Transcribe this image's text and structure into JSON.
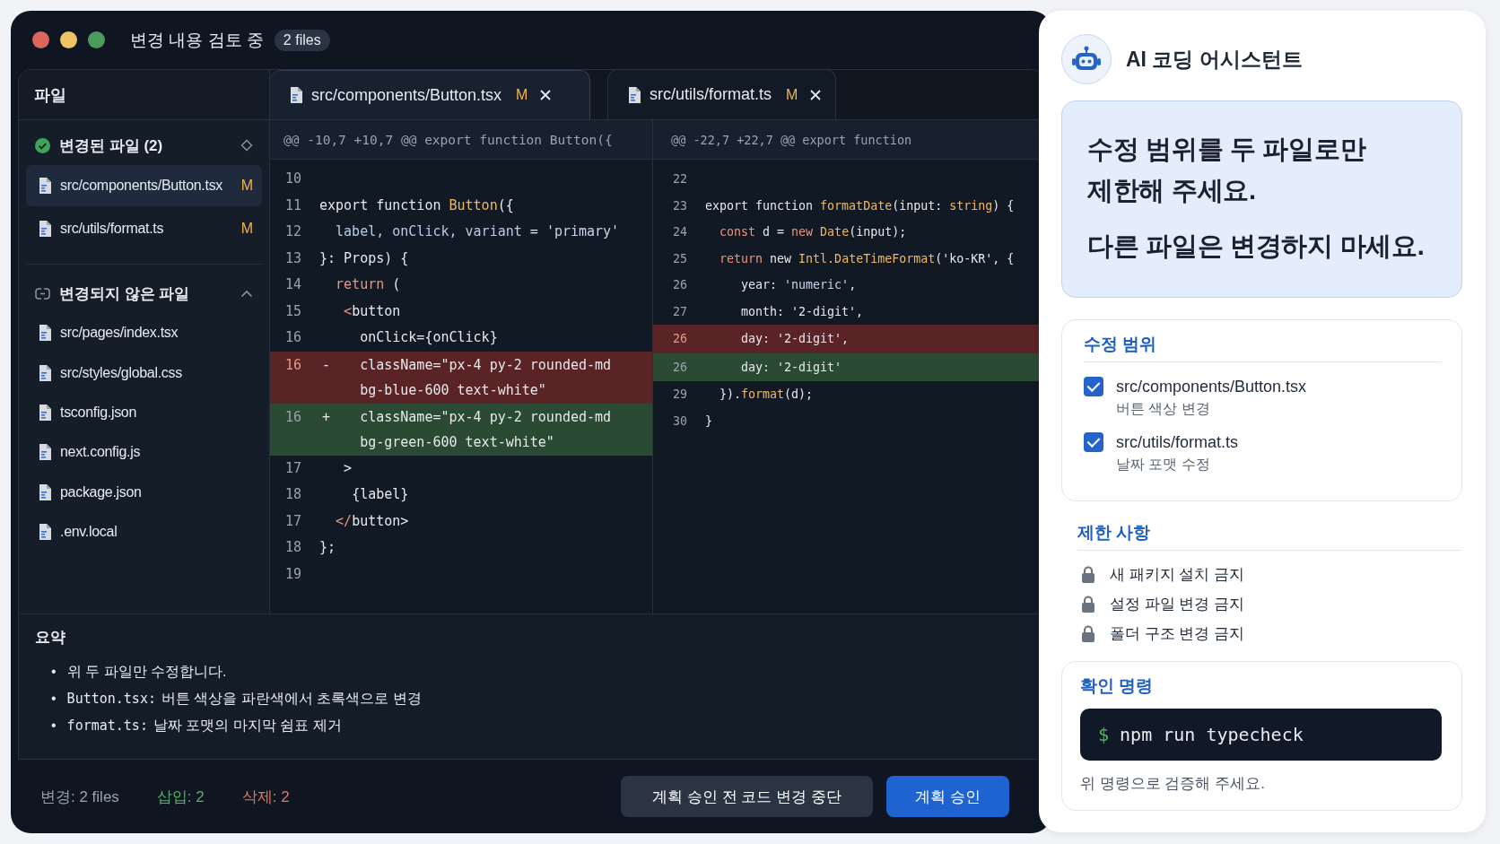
{
  "window": {
    "title": "변경 내용 검토 중",
    "badge": "2 files"
  },
  "sidebar": {
    "title": "파일",
    "groups": [
      {
        "kind": "changed",
        "label": "변경된 파일 (2)",
        "items": [
          {
            "name": "src/components/Button.tsx",
            "status": "M",
            "selected": true
          },
          {
            "name": "src/utils/format.ts",
            "status": "M",
            "selected": false
          }
        ]
      },
      {
        "kind": "unchanged",
        "label": "변경되지 않은 파일",
        "items": [
          {
            "name": "src/pages/index.tsx",
            "selected": false
          },
          {
            "name": "src/styles/global.css",
            "selected": false
          },
          {
            "name": "tsconfig.json",
            "selected": false
          },
          {
            "name": "next.config.js",
            "selected": false
          },
          {
            "name": "package.json",
            "selected": false
          },
          {
            "name": ".env.local",
            "selected": false
          }
        ]
      }
    ]
  },
  "tabs": [
    {
      "label": "src/components/Button.tsx",
      "status": "M",
      "selected": true
    },
    {
      "label": "src/utils/format.ts",
      "status": "M",
      "selected": false
    }
  ],
  "diffs": [
    {
      "hunk": "@@ -10,7 +10,7 @@ export function Button({",
      "lines": [
        {
          "number": "10",
          "kind": "context"
        },
        {
          "number": "11",
          "kind": "context",
          "tokens": [
            {
              "text": "export function ",
              "kind": "plain"
            },
            {
              "text": "Button",
              "kind": "fn"
            },
            {
              "text": "({",
              "kind": "plain"
            }
          ]
        },
        {
          "number": "12",
          "kind": "context",
          "tokens": [
            {
              "text": "  label, onClick, variant",
              "kind": "prop"
            },
            {
              "text": " = ",
              "kind": "plain"
            },
            {
              "text": "'primary'",
              "kind": "str"
            }
          ]
        },
        {
          "number": "13",
          "kind": "context",
          "tokens": [
            {
              "text": "}: Props) {",
              "kind": "plain"
            }
          ]
        },
        {
          "number": "14",
          "kind": "context",
          "tokens": [
            {
              "text": "  return",
              "kind": "kw"
            },
            {
              "text": " (",
              "kind": "plain"
            }
          ]
        },
        {
          "number": "15",
          "kind": "context",
          "tokens": [
            {
              "text": "   <",
              "kind": "kw"
            },
            {
              "text": "button",
              "kind": "plain"
            }
          ]
        },
        {
          "number": "16",
          "kind": "context",
          "tokens": [
            {
              "text": "     onClick={onClick}",
              "kind": "plain"
            }
          ]
        },
        {
          "number": "16",
          "kind": "removed",
          "sign": "-",
          "tokens": [
            {
              "text": "     className=\"px-4 py-2 rounded-md bg-blue-600 text-white\"",
              "kind": "plain"
            }
          ]
        },
        {
          "number": "16",
          "kind": "added",
          "sign": "+",
          "tokens": [
            {
              "text": "     className=\"px-4 py-2 rounded-md bg-green-600 text-white\"",
              "kind": "plain"
            }
          ]
        },
        {
          "number": "17",
          "kind": "context",
          "tokens": [
            {
              "text": "   >",
              "kind": "plain"
            }
          ]
        },
        {
          "number": "18",
          "kind": "context",
          "tokens": [
            {
              "text": "    {label}",
              "kind": "plain"
            }
          ]
        },
        {
          "number": "17",
          "kind": "context",
          "tokens": [
            {
              "text": "  </",
              "kind": "kw"
            },
            {
              "text": "button>",
              "kind": "plain"
            }
          ]
        },
        {
          "number": "18",
          "kind": "context",
          "tokens": [
            {
              "text": "};",
              "kind": "plain"
            }
          ]
        },
        {
          "number": "19",
          "kind": "context"
        }
      ]
    },
    {
      "hunk": "@@ -22,7 +22,7 @@ export function",
      "lines": [
        {
          "number": "22",
          "kind": "context"
        },
        {
          "number": "23",
          "kind": "context",
          "tokens": [
            {
              "text": "export function ",
              "kind": "plain"
            },
            {
              "text": "formatDate",
              "kind": "fn"
            },
            {
              "text": "(input: ",
              "kind": "plain"
            },
            {
              "text": "string",
              "kind": "fn"
            },
            {
              "text": ") {",
              "kind": "plain"
            }
          ]
        },
        {
          "number": "24",
          "kind": "context",
          "tokens": [
            {
              "text": "  const",
              "kind": "kw"
            },
            {
              "text": " d = ",
              "kind": "plain"
            },
            {
              "text": "new ",
              "kind": "kw"
            },
            {
              "text": "Date",
              "kind": "fn"
            },
            {
              "text": "(input);",
              "kind": "plain"
            }
          ]
        },
        {
          "number": "25",
          "kind": "context",
          "tokens": [
            {
              "text": "  return",
              "kind": "kw"
            },
            {
              "text": " new ",
              "kind": "plain"
            },
            {
              "text": "Intl.DateTimeFormat",
              "kind": "fn"
            },
            {
              "text": "('ko-KR', {",
              "kind": "plain"
            }
          ]
        },
        {
          "number": "26",
          "kind": "context",
          "tokens": [
            {
              "text": "     year: ",
              "kind": "plain"
            },
            {
              "text": "'numeric'",
              "kind": "str"
            },
            {
              "text": ",",
              "kind": "plain"
            }
          ]
        },
        {
          "number": "27",
          "kind": "context",
          "tokens": [
            {
              "text": "     month: '2-digit',",
              "kind": "plain"
            }
          ]
        },
        {
          "number": "26",
          "kind": "removed",
          "tokens": [
            {
              "text": "     day: '2-digit',",
              "kind": "plain"
            }
          ]
        },
        {
          "number": "26",
          "kind": "added",
          "tokens": [
            {
              "text": "     day: '2-digit'",
              "kind": "plain"
            }
          ]
        },
        {
          "number": "29",
          "kind": "context",
          "tokens": [
            {
              "text": "  }).",
              "kind": "plain"
            },
            {
              "text": "format",
              "kind": "fn"
            },
            {
              "text": "(d);",
              "kind": "plain"
            }
          ]
        },
        {
          "number": "30",
          "kind": "context",
          "tokens": [
            {
              "text": "}",
              "kind": "plain"
            }
          ]
        }
      ]
    }
  ],
  "summary": {
    "title": "요약",
    "items": [
      {
        "marker": "•",
        "text": "위 두 파일만 수정합니다."
      },
      {
        "marker": "•",
        "code": "Button.tsx:",
        "text": "버튼 색상을 파란색에서 초록색으로 변경"
      },
      {
        "marker": "•",
        "code": "format.ts:",
        "text": "날짜 포맷의 마지막 쉼표 제거"
      }
    ]
  },
  "footer": {
    "stats": [
      {
        "text": "변경: 2 files",
        "kind": "total"
      },
      {
        "text": "삽입: 2",
        "kind": "added"
      },
      {
        "text": "삭제: 2",
        "kind": "removed"
      }
    ],
    "buttons": [
      {
        "label": "계획 승인 전 코드 변경 중단",
        "kind": "secondary"
      },
      {
        "label": "계획 승인",
        "kind": "primary"
      }
    ]
  },
  "assistant": {
    "title": "AI 코딩 어시스턴트",
    "message": [
      "수정 범위를 두 파일로만 제한해 주세요.",
      "다른 파일은 변경하지 마세요."
    ],
    "scope": {
      "title": "수정 범위",
      "items": [
        {
          "path": "src/components/Button.tsx",
          "description": "버튼 색상 변경",
          "checked": true
        },
        {
          "path": "src/utils/format.ts",
          "description": "날짜 포맷 수정",
          "checked": true
        }
      ]
    },
    "restrictions": {
      "title": "제한 사항",
      "items": [
        "새 패키지 설치 금지",
        "설정 파일 변경 금지",
        "폴더 구조 변경 금지"
      ]
    },
    "verify": {
      "title": "확인 명령",
      "prompt": "$",
      "command": "npm run typecheck",
      "note": "위 명령으로 검증해 주세요."
    }
  }
}
